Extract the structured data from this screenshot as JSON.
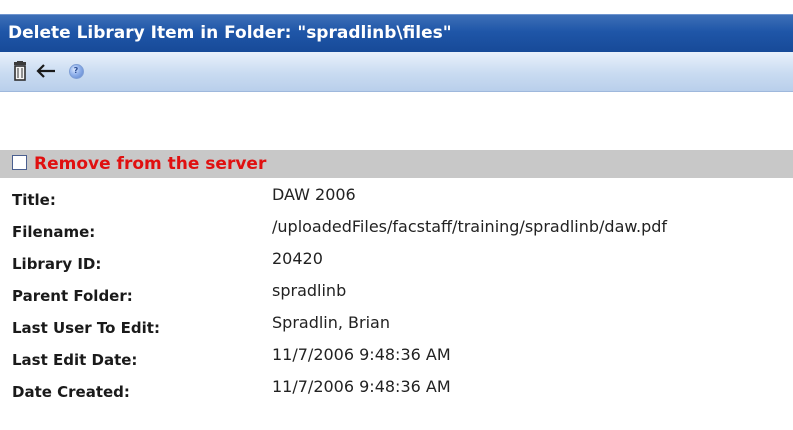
{
  "dialog": {
    "title": "Delete Library Item in Folder: \"spradlinb\\files\""
  },
  "toolbar": {
    "buttons": [
      {
        "icon": "trash-icon",
        "action": "delete"
      },
      {
        "icon": "back-arrow-icon",
        "action": "back"
      },
      {
        "icon": "help-icon",
        "action": "help"
      }
    ]
  },
  "remove_option": {
    "label": "Remove from the server",
    "checked": false,
    "color": "#e01010"
  },
  "properties": [
    {
      "label": "Title:",
      "value": "DAW 2006"
    },
    {
      "label": "Filename:",
      "value": "/uploadedFiles/facstaff/training/spradlinb/daw.pdf"
    },
    {
      "label": "Library ID:",
      "value": "20420"
    },
    {
      "label": "Parent Folder:",
      "value": "spradlinb"
    },
    {
      "label": "Last User To Edit:",
      "value": "Spradlin, Brian"
    },
    {
      "label": "Last Edit Date:",
      "value": "11/7/2006 9:48:36 AM"
    },
    {
      "label": "Date Created:",
      "value": "11/7/2006 9:48:36 AM"
    }
  ],
  "colors": {
    "titlebar": "#1f56a8",
    "toolbar": "#c9dbf1",
    "remove_bar": "#c8c8c8"
  }
}
